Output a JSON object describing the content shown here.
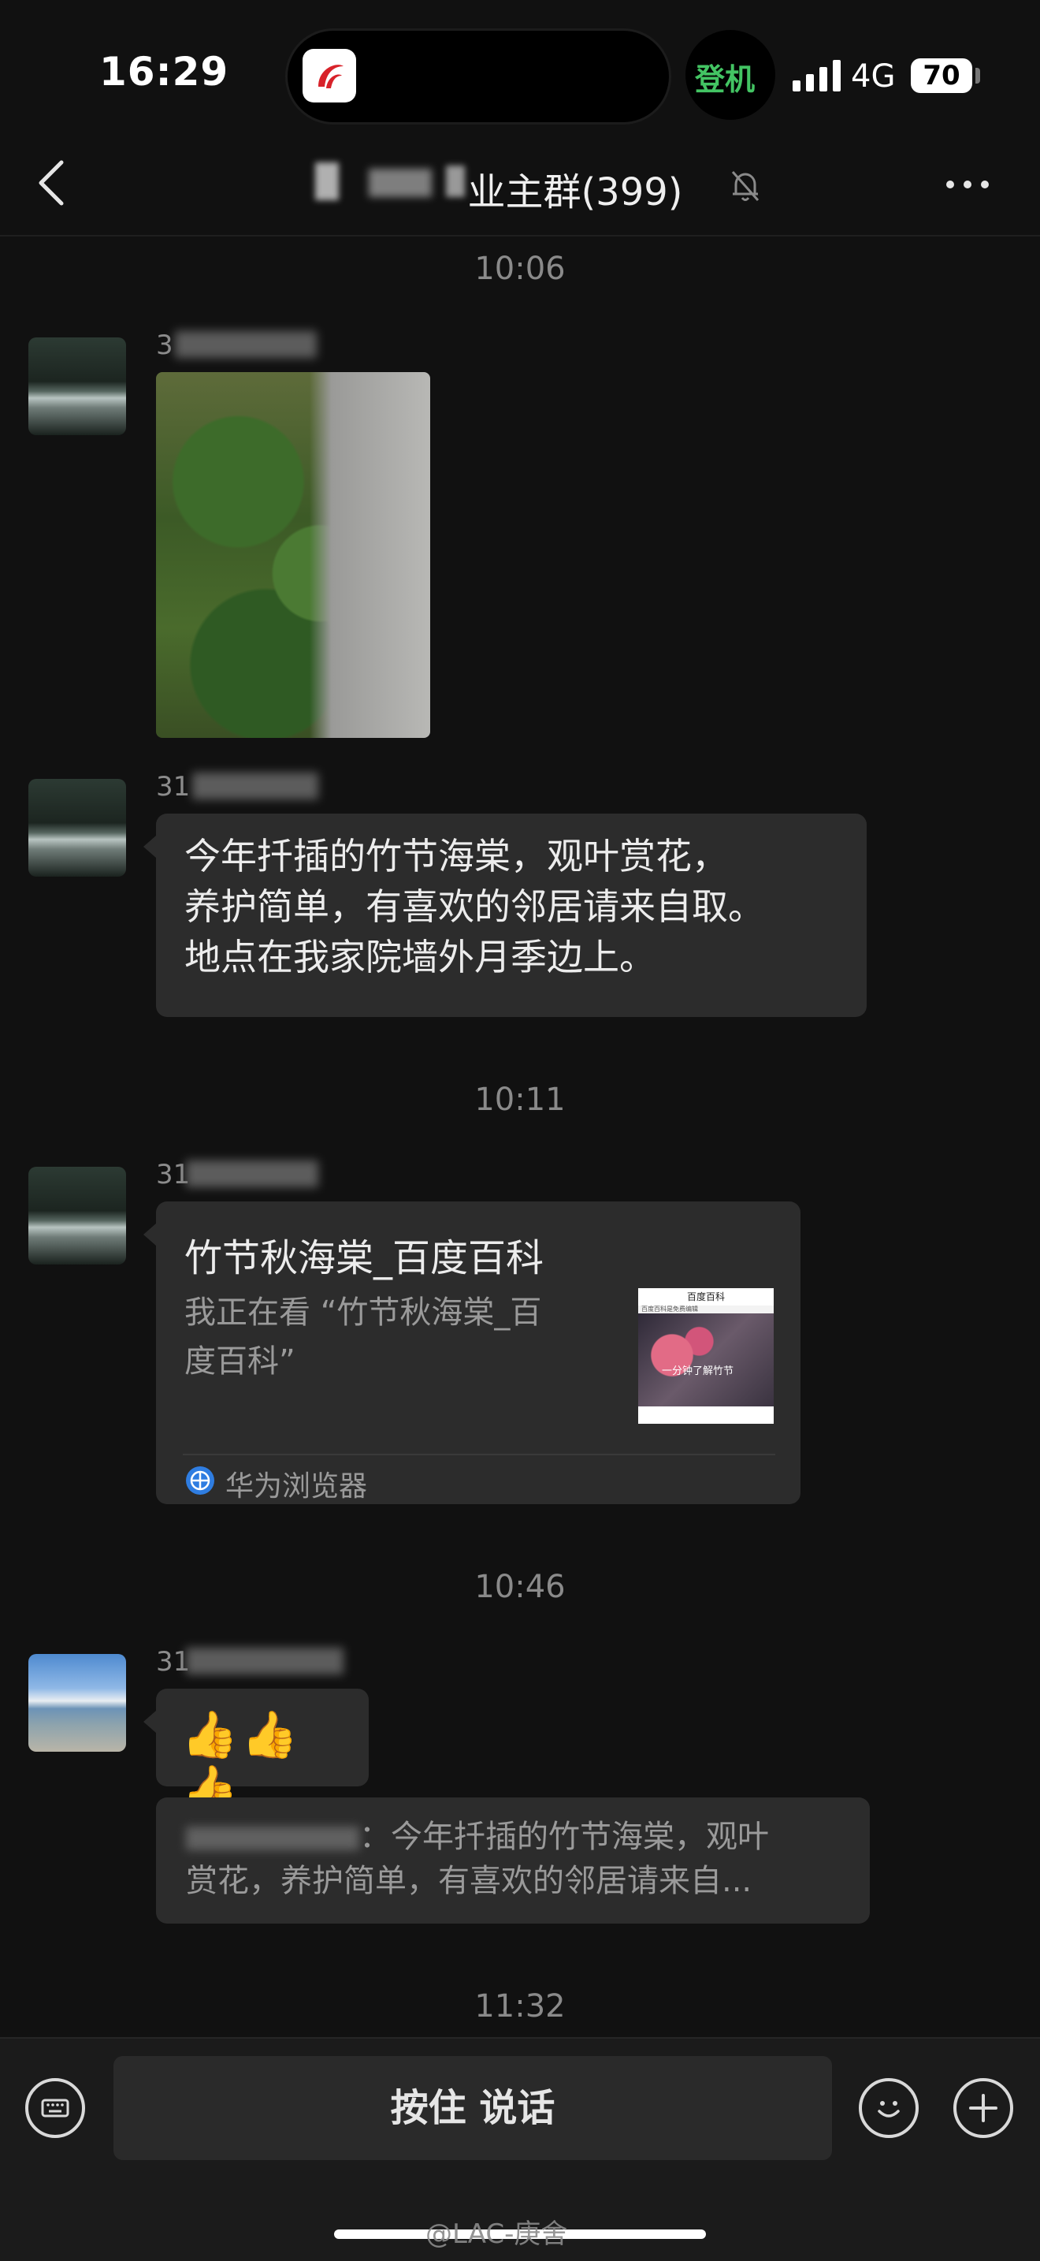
{
  "status_bar": {
    "time": "16:29",
    "login": "登机",
    "network": "4G",
    "battery": "70"
  },
  "nav": {
    "title": "业主群(399)",
    "back_icon": "chevron-left-icon",
    "mute_icon": "bell-slash-icon",
    "more_icon": "ellipsis-icon"
  },
  "chat": {
    "timestamps": [
      "10:06",
      "10:11",
      "10:46",
      "11:32"
    ],
    "messages": [
      {
        "sender": "3",
        "type": "image"
      },
      {
        "sender": "31",
        "type": "text",
        "lines": [
          "今年扦插的竹节海棠，观叶赏花，",
          "养护简单，有喜欢的邻居请来自取。",
          "地点在我家院墙外月季边上。"
        ]
      },
      {
        "sender": "31",
        "type": "link",
        "title": "竹节秋海棠_百度百科",
        "desc_lines": [
          "我正在看 “竹节秋海棠_百",
          "度百科”"
        ],
        "thumb_header": "百度百科",
        "thumb_bar": "百度百科是免费编辑",
        "thumb_caption": "一分钟了解竹节",
        "source": "华为浏览器"
      },
      {
        "sender": "31",
        "type": "emoji",
        "text": "👍👍👍",
        "quote_lines": [
          "：今年扦插的竹节海棠，观叶",
          "赏花，养护简单，有喜欢的邻居请来自..."
        ]
      }
    ]
  },
  "input_bar": {
    "talk_label": "按住 说话",
    "keyboard_icon": "keyboard-icon",
    "emoji_icon": "smiley-icon",
    "plus_icon": "plus-circle-icon"
  },
  "watermark": "@LAC-庚舍"
}
